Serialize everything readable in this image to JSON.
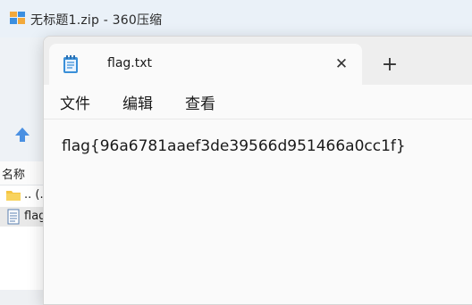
{
  "background_window": {
    "title": "无标题1.zip - 360压缩",
    "list_header": "名称",
    "rows": [
      {
        "name": ".. (..."
      },
      {
        "name": "flag"
      }
    ]
  },
  "notepad": {
    "tab_title": "flag.txt",
    "close_glyph": "✕",
    "new_tab_glyph": "+",
    "menu": [
      "文件",
      "编辑",
      "查看"
    ],
    "content": "flag{96a6781aaef3de39566d951466a0cc1f}"
  }
}
